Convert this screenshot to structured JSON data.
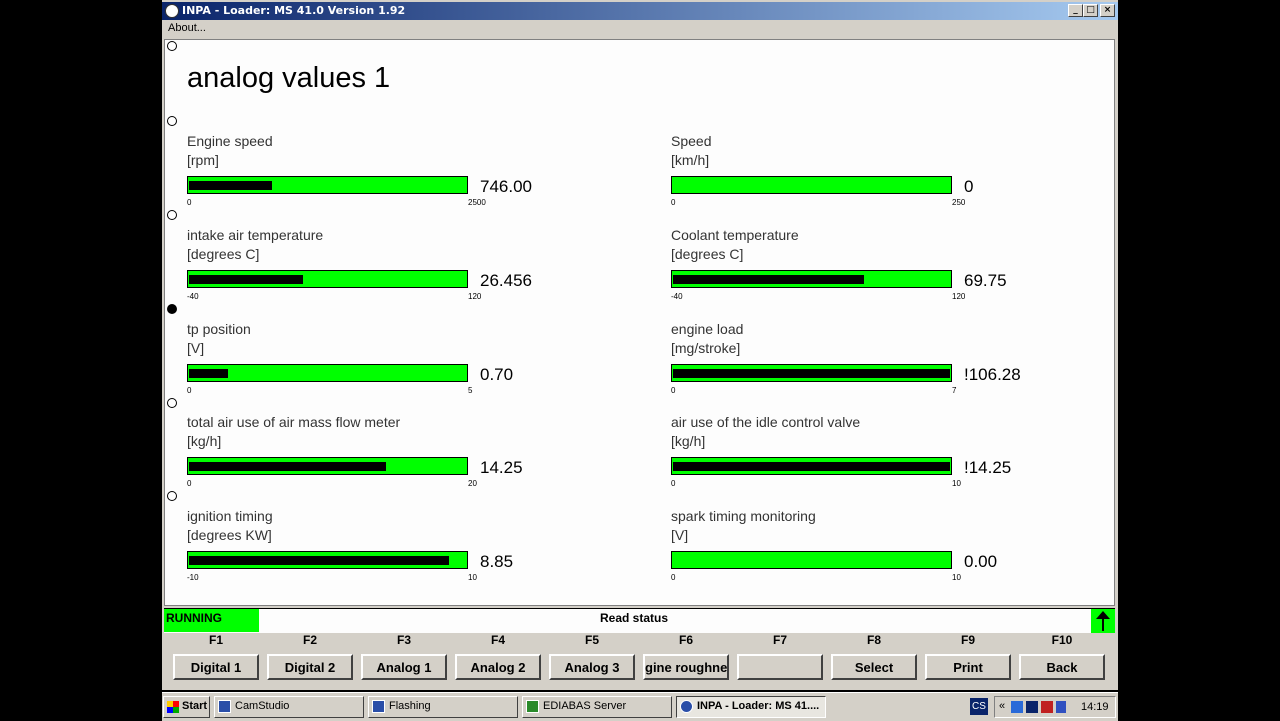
{
  "window": {
    "title": "INPA - Loader: MS 41.0 Version 1.92",
    "menu": "About...",
    "controls": [
      "_",
      "□",
      "×"
    ]
  },
  "page_title": "analog values 1",
  "gauges": [
    {
      "label": "Engine speed",
      "unit": "[rpm]",
      "value": "746.00",
      "min": "0",
      "max": "2500",
      "fill": 0.3
    },
    {
      "label": "Speed",
      "unit": "[km/h]",
      "value": "0",
      "min": "0",
      "max": "250",
      "fill": 0.0
    },
    {
      "label": "intake air temperature",
      "unit": "[degrees C]",
      "value": "26.456",
      "min": "-40",
      "max": "120",
      "fill": 0.41
    },
    {
      "label": "Coolant temperature",
      "unit": "[degrees C]",
      "value": "69.75",
      "min": "-40",
      "max": "120",
      "fill": 0.69
    },
    {
      "label": "tp position",
      "unit": "[V]",
      "value": "0.70",
      "min": "0",
      "max": "5",
      "fill": 0.14
    },
    {
      "label": "engine load",
      "unit": "[mg/stroke]",
      "value": "!106.28",
      "min": "0",
      "max": "7",
      "fill": 1.0
    },
    {
      "label": "total air use of air mass flow meter",
      "unit": "[kg/h]",
      "value": "14.25",
      "min": "0",
      "max": "20",
      "fill": 0.71
    },
    {
      "label": "air use of the idle control valve",
      "unit": "[kg/h]",
      "value": "!14.25",
      "min": "0",
      "max": "10",
      "fill": 1.0
    },
    {
      "label": "ignition timing",
      "unit": "[degrees KW]",
      "value": "8.85",
      "min": "-10",
      "max": "10",
      "fill": 0.94
    },
    {
      "label": "spark timing monitoring",
      "unit": "[V]",
      "value": "0.00",
      "min": "0",
      "max": "10",
      "fill": 0.0
    }
  ],
  "status": {
    "state": "RUNNING",
    "text": "Read status"
  },
  "fkeys": [
    {
      "key": "F1",
      "label": "Digital 1"
    },
    {
      "key": "F2",
      "label": "Digital 2"
    },
    {
      "key": "F3",
      "label": "Analog 1"
    },
    {
      "key": "F4",
      "label": "Analog 2"
    },
    {
      "key": "F5",
      "label": "Analog 3"
    },
    {
      "key": "F6",
      "label": "gine roughne"
    },
    {
      "key": "F7",
      "label": ""
    },
    {
      "key": "F8",
      "label": "Select"
    },
    {
      "key": "F9",
      "label": "Print"
    },
    {
      "key": "F10",
      "label": "Back"
    }
  ],
  "taskbar": {
    "start": "Start",
    "tasks": [
      {
        "label": "CamStudio"
      },
      {
        "label": "Flashing"
      },
      {
        "label": "EDIABAS Server"
      },
      {
        "label": "INPA - Loader: MS 41...."
      }
    ],
    "lang": "CS",
    "clock": "14:19"
  },
  "colors": {
    "bar": "#00ff00",
    "fill": "#000000",
    "titlebar": "#0a246a"
  }
}
